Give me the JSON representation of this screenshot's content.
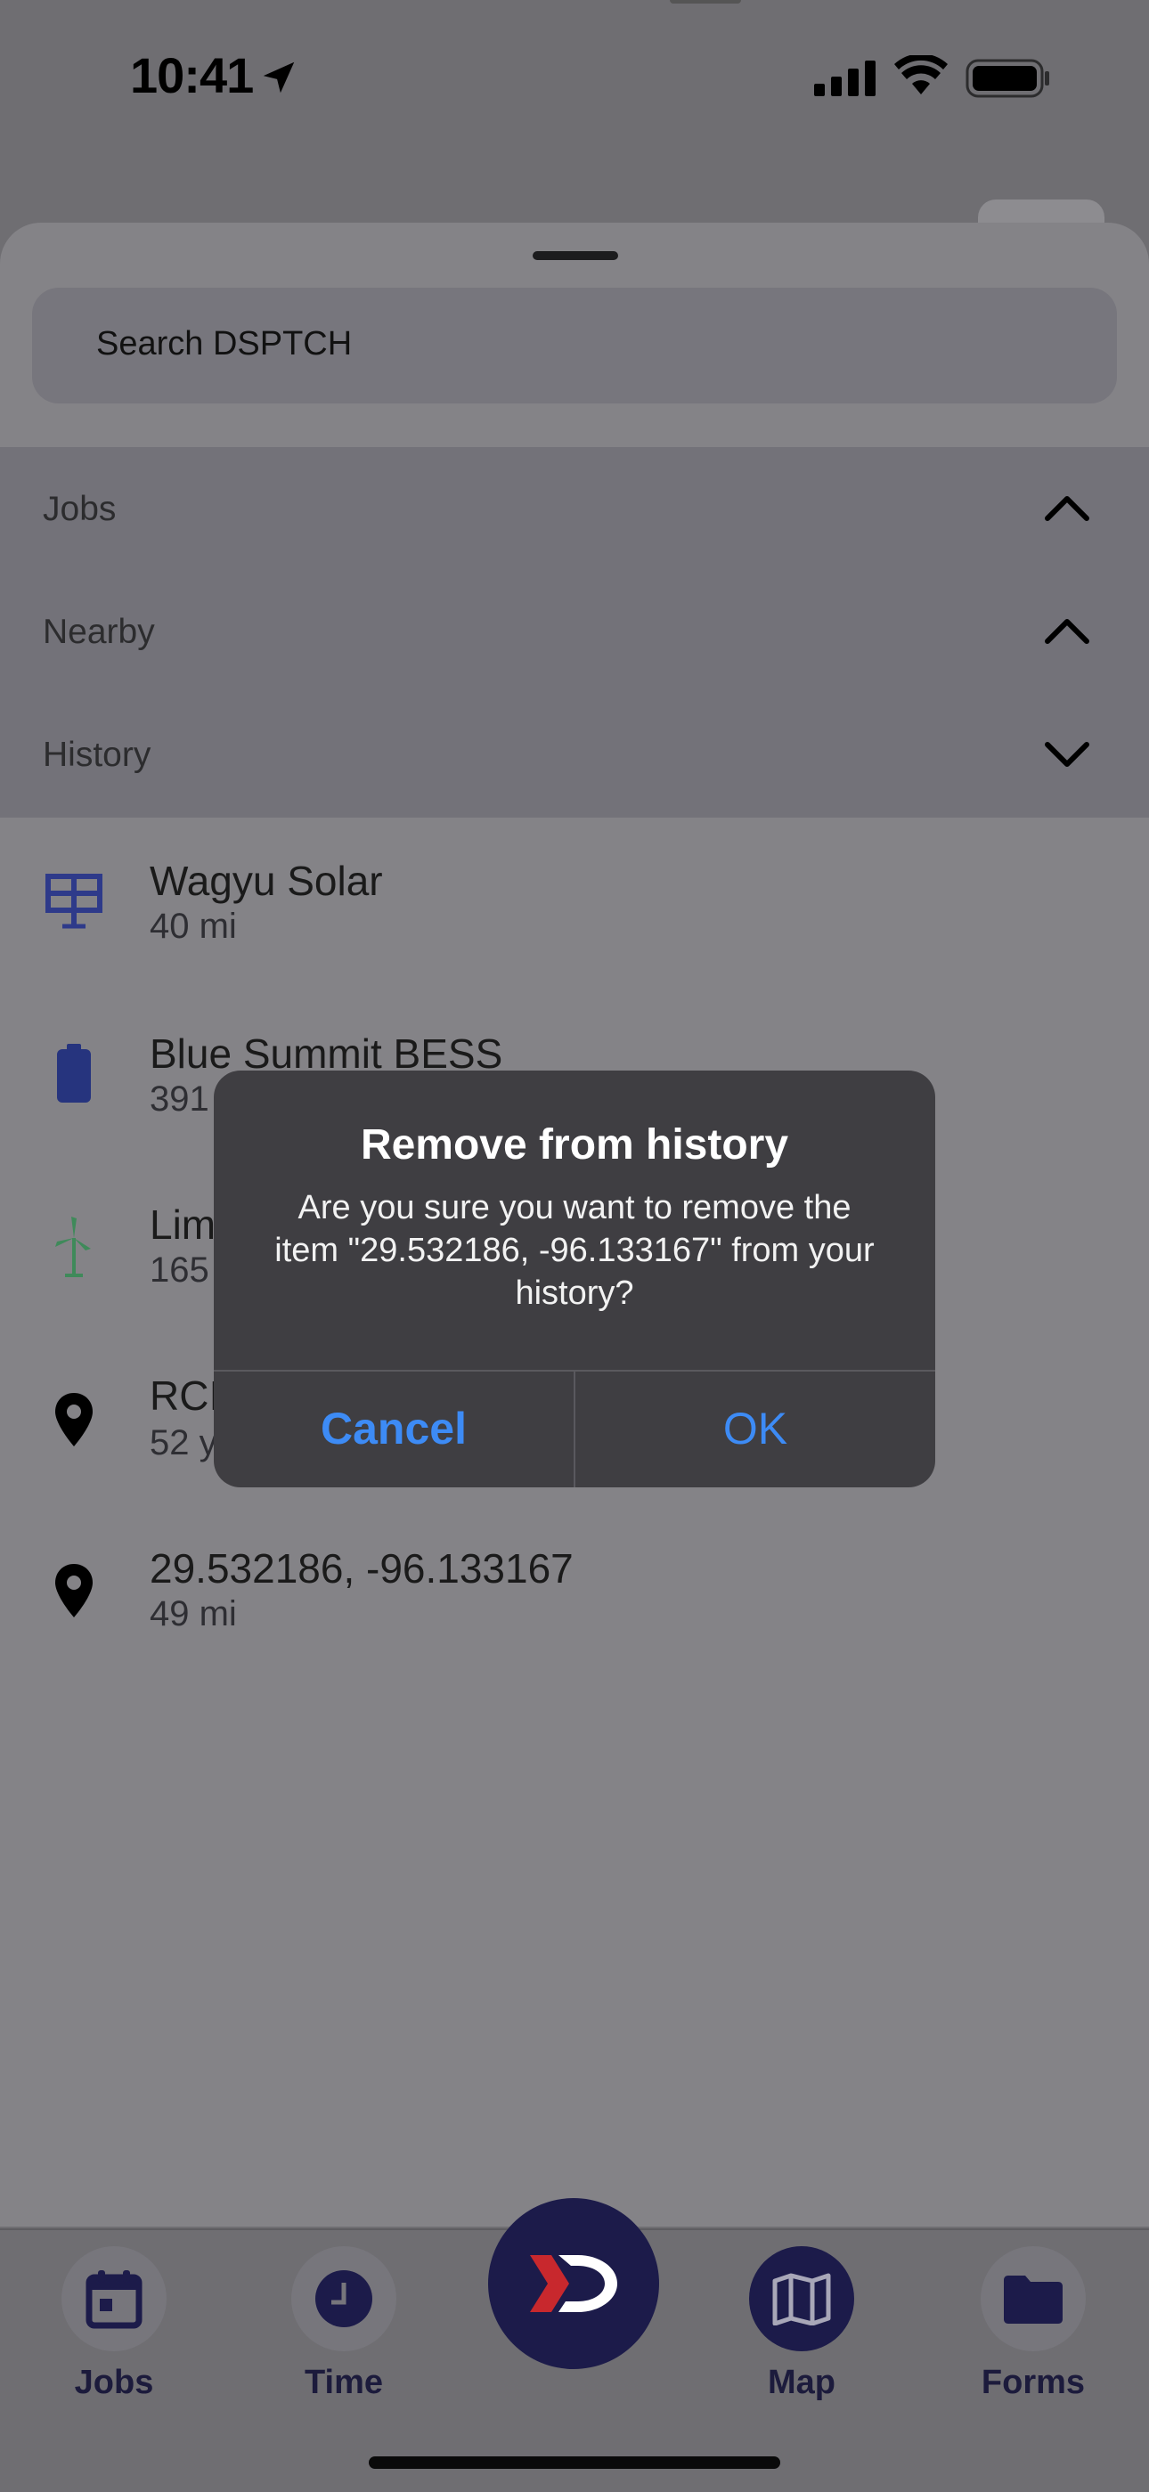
{
  "status_bar": {
    "time": "10:41"
  },
  "search": {
    "placeholder": "Search DSPTCH"
  },
  "sections": [
    {
      "label": "Jobs",
      "state": "expanded"
    },
    {
      "label": "Nearby",
      "state": "expanded"
    },
    {
      "label": "History",
      "state": "collapsed"
    }
  ],
  "history_items": [
    {
      "title": "Wagyu Solar",
      "subtitle": "40 mi",
      "icon": "solar-panel-icon"
    },
    {
      "title": "Blue Summit BESS",
      "subtitle": "391 mi",
      "icon": "battery-icon"
    },
    {
      "title": "Lim",
      "subtitle": "165",
      "icon": "wind-turbine-icon"
    },
    {
      "title": "RCI",
      "subtitle": "52 y",
      "icon": "map-pin-icon"
    },
    {
      "title": "29.532186, -96.133167",
      "subtitle": "49 mi",
      "icon": "map-pin-icon"
    }
  ],
  "dialog": {
    "title": "Remove from history",
    "message": "Are you sure you want to remove the item \"29.532186, -96.133167\" from your history?",
    "cancel_label": "Cancel",
    "ok_label": "OK"
  },
  "tabbar": {
    "jobs_label": "Jobs",
    "time_label": "Time",
    "map_label": "Map",
    "forms_label": "Forms",
    "active_tab": "Map"
  },
  "colors": {
    "accent_blue": "#3d8bf5",
    "brand_navy": "#1c1b4a",
    "brand_red": "#c8282d"
  }
}
